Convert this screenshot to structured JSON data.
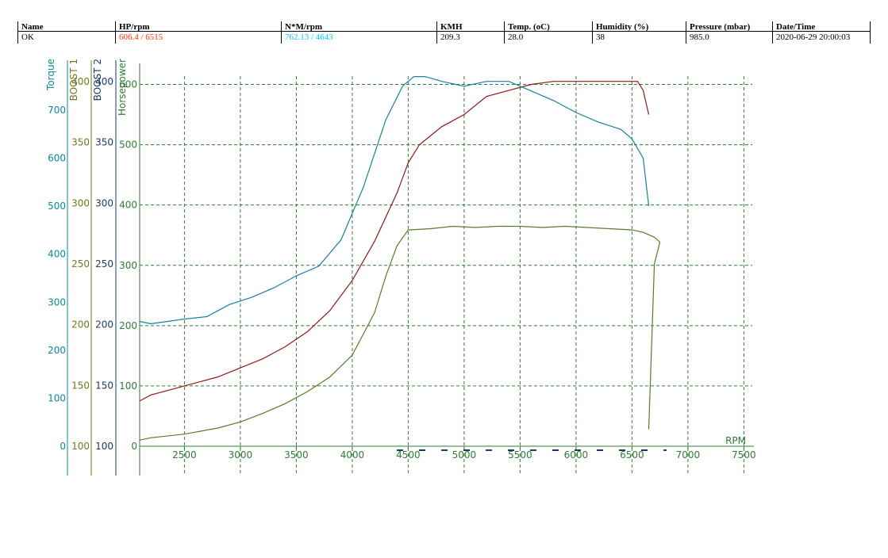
{
  "header": {
    "columns": [
      {
        "label": "Name",
        "value": "OK",
        "color": "#000000"
      },
      {
        "label": "HP/rpm",
        "value": "606.4 / 6515",
        "color": "#ff3300"
      },
      {
        "label": "N*M/rpm",
        "value": "762.13 / 4643",
        "color": "#00ccff"
      },
      {
        "label": "KMH",
        "value": "209.3",
        "color": "#000000"
      },
      {
        "label": "Temp. (oC)",
        "value": "28.0",
        "color": "#000000"
      },
      {
        "label": "Humidity (%)",
        "value": "38",
        "color": "#000000"
      },
      {
        "label": "Pressure (mbar)",
        "value": "985.0",
        "color": "#000000"
      },
      {
        "label": "Date/Time",
        "value": "2020-06-29 20:00:03",
        "color": "#000000"
      }
    ]
  },
  "chart_data": {
    "type": "line",
    "xlabel": "RPM",
    "xlim": [
      2100,
      7600
    ],
    "xticks": [
      2500,
      3000,
      3500,
      4000,
      4500,
      5000,
      5500,
      6000,
      6500,
      7000,
      7500
    ],
    "grid": true,
    "axes": [
      {
        "name": "Torque",
        "color": "#0a8a9a",
        "ticks": [
          0,
          100,
          200,
          300,
          400,
          500,
          600,
          700
        ],
        "range": [
          0,
          826
        ]
      },
      {
        "name": "BOOST 1",
        "color": "#6e7a1e",
        "ticks": [
          100,
          150,
          200,
          250,
          300,
          350,
          400
        ],
        "range": [
          100,
          400
        ]
      },
      {
        "name": "BOOST 2",
        "color": "#1a3a66",
        "ticks": [
          100,
          150,
          200,
          250,
          300,
          350,
          400
        ],
        "range": [
          100,
          400
        ]
      },
      {
        "name": "Horsepower",
        "color": "#2e7d32",
        "ticks": [
          0,
          100,
          200,
          300,
          400,
          500,
          600
        ],
        "range": [
          0,
          600
        ]
      }
    ],
    "series": [
      {
        "axis": "Horsepower",
        "color": "#8b1a1a",
        "x": [
          2100,
          2200,
          2500,
          2800,
          3000,
          3200,
          3400,
          3600,
          3800,
          4000,
          4200,
          4400,
          4500,
          4600,
          4800,
          5000,
          5200,
          5400,
          5600,
          5800,
          6000,
          6200,
          6400,
          6550,
          6600,
          6650
        ],
        "y": [
          75,
          85,
          100,
          115,
          130,
          145,
          165,
          190,
          225,
          275,
          340,
          420,
          470,
          500,
          530,
          550,
          580,
          590,
          600,
          605,
          605,
          605,
          605,
          605,
          590,
          550
        ]
      },
      {
        "axis": "Torque",
        "color": "#1a7fa0",
        "x": [
          2100,
          2200,
          2500,
          2700,
          2900,
          3100,
          3300,
          3500,
          3700,
          3900,
          4100,
          4300,
          4450,
          4550,
          4650,
          4800,
          5000,
          5200,
          5400,
          5600,
          5800,
          6000,
          6200,
          6400,
          6500,
          6600,
          6650
        ],
        "y": [
          260,
          255,
          265,
          270,
          295,
          310,
          330,
          355,
          375,
          430,
          540,
          680,
          750,
          770,
          770,
          760,
          750,
          760,
          760,
          740,
          720,
          695,
          675,
          660,
          640,
          600,
          500
        ]
      },
      {
        "axis": "BOOST 1",
        "color": "#5a7a2a",
        "x": [
          2100,
          2200,
          2500,
          2800,
          3000,
          3200,
          3400,
          3600,
          3800,
          4000,
          4200,
          4300,
          4400,
          4500,
          4700,
          4900,
          5100,
          5300,
          5500,
          5700,
          5900,
          6100,
          6300,
          6500,
          6600,
          6700,
          6750,
          6700,
          6650
        ],
        "y": [
          105,
          107,
          110,
          115,
          120,
          127,
          135,
          145,
          157,
          175,
          210,
          240,
          265,
          278,
          279,
          281,
          280,
          281,
          281,
          280,
          281,
          280,
          279,
          278,
          276,
          272,
          268,
          250,
          114
        ]
      }
    ]
  }
}
